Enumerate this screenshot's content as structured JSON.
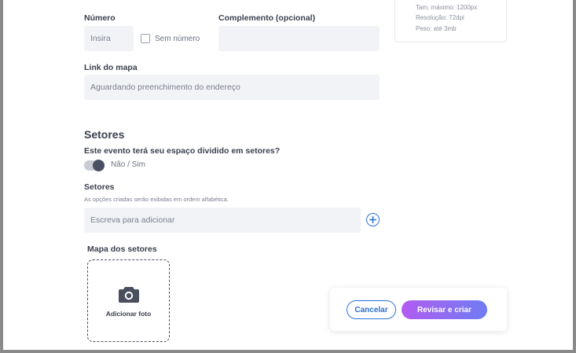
{
  "colors": {
    "accent": "#2a74d8",
    "gradient_start": "#b15cf0",
    "gradient_end": "#6f7cf2",
    "field_bg": "#f2f3f6"
  },
  "image_specs": {
    "max_size": "Tam. máximo: 1200px",
    "resolution": "Resolução: 72dpi",
    "weight": "Peso: até 3mb"
  },
  "address": {
    "number_label": "Número",
    "number_placeholder": "Insira",
    "no_number_label": "Sem número",
    "complement_label": "Complemento (opcional)",
    "complement_value": "",
    "map_link_label": "Link do mapa",
    "map_link_placeholder": "Aguardando preenchimento do endereço"
  },
  "sectors": {
    "title": "Setores",
    "question": "Este evento terá seu espaço dividido em setores?",
    "toggle_label": "Não / Sim",
    "toggle_on": true,
    "field_label": "Setores",
    "helper": "As opções criadas serão exibidas em ordem alfabética.",
    "input_placeholder": "Escreva para adicionar",
    "add_icon": "plus-circle-icon",
    "map_label": "Mapa dos setores",
    "upload_icon": "camera-icon",
    "upload_label": "Adicionar foto"
  },
  "footer": {
    "cancel_label": "Cancelar",
    "submit_label": "Revisar e criar"
  }
}
